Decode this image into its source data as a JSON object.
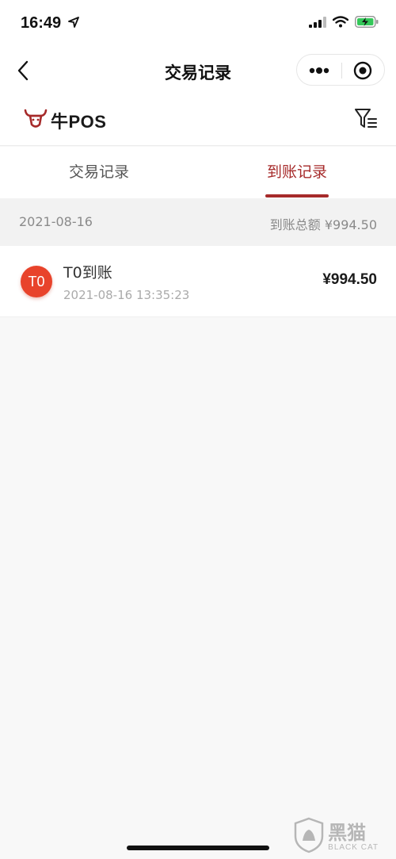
{
  "status_bar": {
    "time": "16:49",
    "icons": [
      "location-arrow-icon",
      "cellular-signal-icon",
      "wifi-icon",
      "battery-charging-icon"
    ]
  },
  "nav": {
    "title": "交易记录",
    "icons": [
      "back-chevron-icon",
      "more-dots-icon",
      "close-target-icon"
    ]
  },
  "brand": {
    "logo_text": "牛POS",
    "accent_color": "#a62a2a"
  },
  "tabs": [
    {
      "label": "交易记录",
      "active": false
    },
    {
      "label": "到账记录",
      "active": true
    }
  ],
  "summary": {
    "date": "2021-08-16",
    "total_label": "到账总额",
    "total_value": "¥994.50"
  },
  "records": [
    {
      "badge": "T0",
      "title": "T0到账",
      "time": "2021-08-16 13:35:23",
      "amount": "¥994.50",
      "badge_color": "#e8432b"
    }
  ],
  "watermark": {
    "cn": "黑猫",
    "en": "BLACK CAT"
  }
}
